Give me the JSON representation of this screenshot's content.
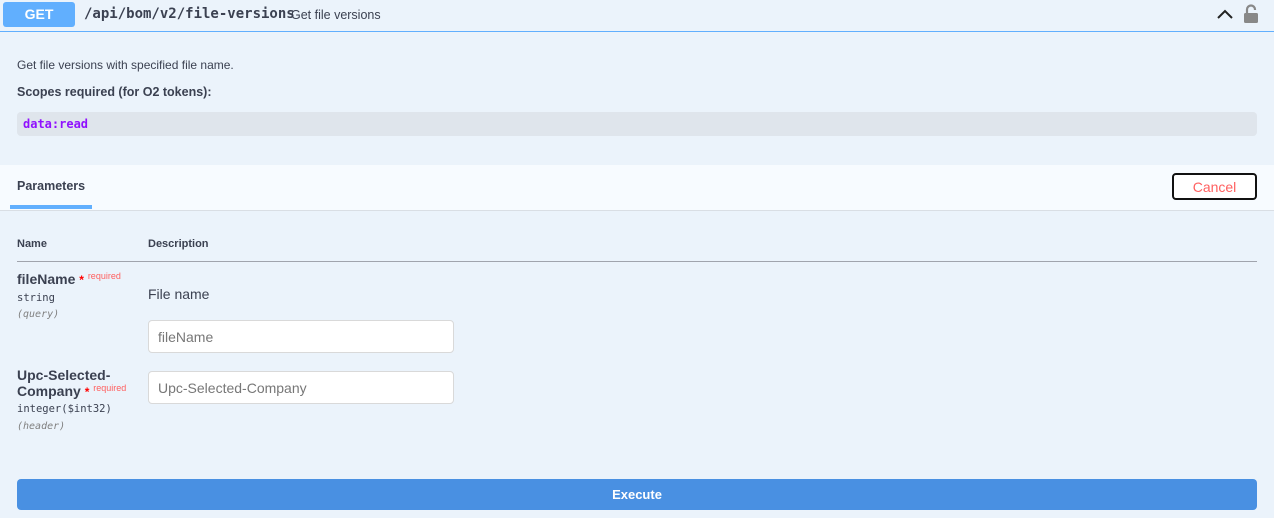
{
  "operation": {
    "method": "GET",
    "path": "/api/bom/v2/file-versions",
    "summary": "Get file versions"
  },
  "description": "Get file versions with specified file name.",
  "scopes_label": "Scopes required (for O2 tokens):",
  "scope": "data:read",
  "parameters_tab": "Parameters",
  "cancel_label": "Cancel",
  "columns": {
    "name": "Name",
    "description": "Description"
  },
  "params": [
    {
      "name": "fileName",
      "star": "*",
      "required": "required",
      "type": "string",
      "in": "(query)",
      "description": "File name",
      "placeholder": "fileName"
    },
    {
      "name": "Upc-Selected-Company",
      "name_line1": "Upc-Selected-",
      "name_line2": "Company",
      "star": "*",
      "required": "required",
      "type": "integer($int32)",
      "in": "(header)",
      "placeholder": "Upc-Selected-Company"
    }
  ],
  "execute_label": "Execute"
}
